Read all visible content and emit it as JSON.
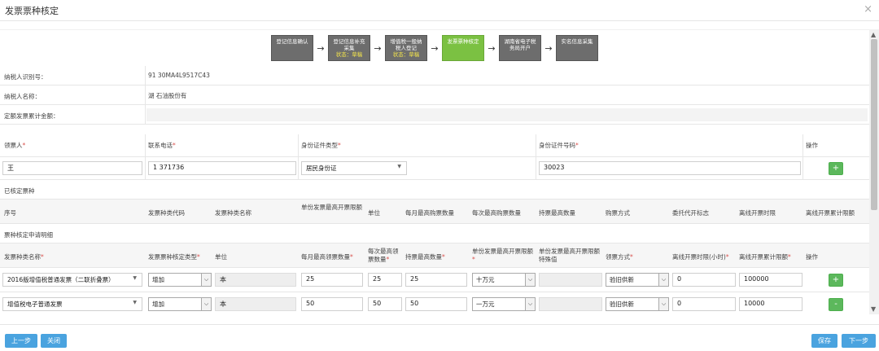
{
  "dialog": {
    "title": "发票票种核定",
    "close": "×"
  },
  "steps": [
    {
      "l1": "登记信息确认",
      "l2": "",
      "l3": ""
    },
    {
      "l1": "登记信息补充",
      "l2": "采集",
      "l3": "状态：草稿"
    },
    {
      "l1": "增值税一般纳",
      "l2": "税人登记",
      "l3": "状态：草稿"
    },
    {
      "l1": "发票票种核定",
      "l2": "",
      "l3": ""
    },
    {
      "l1": "湖南省电子税",
      "l2": "务局开户",
      "l3": ""
    },
    {
      "l1": "实名信息采集",
      "l2": "",
      "l3": ""
    }
  ],
  "arrow": "→",
  "info": {
    "taxpayer_id_label": "纳税人识别号：",
    "taxpayer_id_value": "91       30MA4L9517C43",
    "taxpayer_name_label": "纳税人名称：",
    "taxpayer_name_value": "湖        石油股份有",
    "quota_label": "定额发票累计金额："
  },
  "person": {
    "col_recipient": "领票人",
    "col_phone": "联系电话",
    "col_idtype": "身份证件类型",
    "col_idno": "身份证件号码",
    "col_op": "操作",
    "recipient": "王",
    "phone": "1      371736",
    "idtype": "居民身份证",
    "idno": "                30023",
    "add": "+"
  },
  "approved": {
    "section": "已核定票种",
    "headers": [
      "序号",
      "发票种类代码",
      "发票种类名称",
      "单份发票最高开票限额",
      "单位",
      "每月最高购票数量",
      "每次最高购票数量",
      "持票最高数量",
      "购票方式",
      "委托代开标志",
      "离线开票时限",
      "离线开票累计限额"
    ]
  },
  "apply": {
    "section": "票种核定申请明细",
    "headers": {
      "name": "发票种类名称",
      "type": "发票票种核定类型",
      "unit": "单位",
      "month": "每月最高领票数量",
      "once": "每次最高领票数量",
      "hold": "持票最高数量",
      "limit": "单份发票最高开票限额",
      "limit_special": "单份发票最高开票限额特殊值",
      "method": "领票方式",
      "offline_hours": "离线开票时限(小时)",
      "offline_total": "离线开票累计限额",
      "op": "操作"
    },
    "rows": [
      {
        "name": "2016版增值税普通发票（二联折叠票）",
        "type": "增加",
        "unit": "本",
        "month": "25",
        "once": "25",
        "hold": "25",
        "limit": "十万元",
        "method": "验旧供新",
        "offline_hours": "0",
        "offline_total": "100000",
        "op": "+"
      },
      {
        "name": "增值税电子普通发票",
        "type": "增加",
        "unit": "本",
        "month": "50",
        "once": "50",
        "hold": "50",
        "limit": "一万元",
        "method": "验旧供新",
        "offline_hours": "0",
        "offline_total": "10000",
        "op": "-"
      }
    ]
  },
  "footer": {
    "prev": "上一步",
    "close": "关闭",
    "save": "保存",
    "next": "下一步"
  },
  "colors": {
    "active_step": "#7bc142",
    "step": "#6d6d6d",
    "button": "#4aa3df",
    "green": "#5cb85c"
  }
}
